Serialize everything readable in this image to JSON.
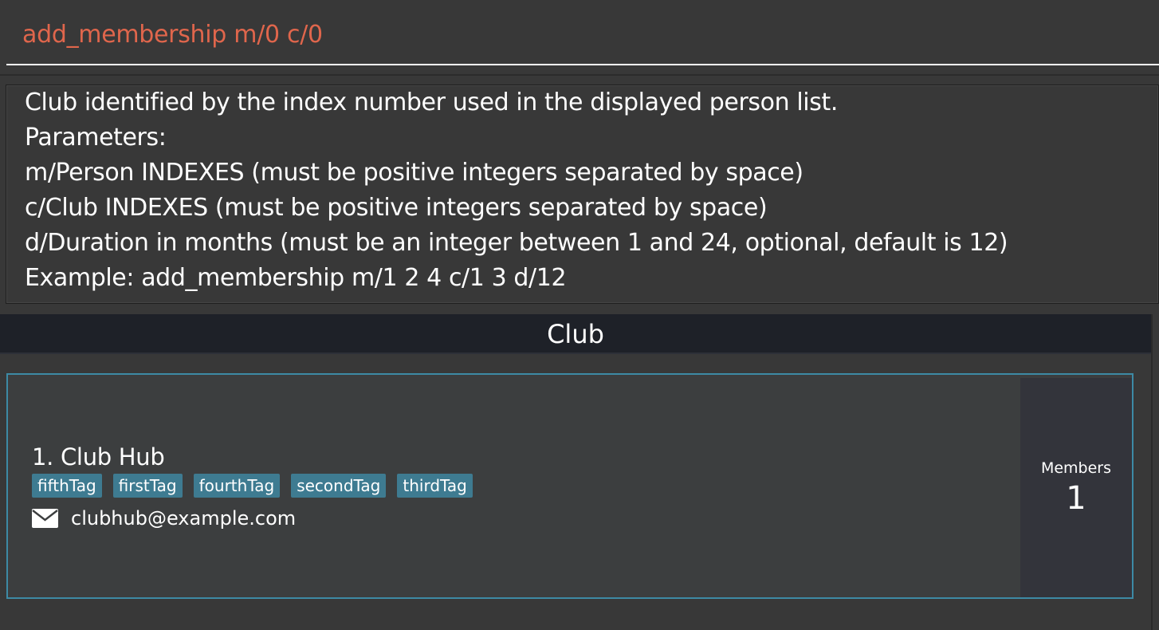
{
  "command": {
    "value": "add_membership m/0 c/0"
  },
  "result": {
    "lines": [
      "Club identified by the index number used in the displayed person list.",
      "Parameters:",
      "m/Person INDEXES (must be positive integers separated by space)",
      "c/Club INDEXES (must be positive integers separated by space)",
      "d/Duration in months (must be an integer between 1 and 24, optional, default is 12)",
      "Example: add_membership m/1 2 4 c/1 3 d/12"
    ]
  },
  "list_pane": {
    "title": "Club"
  },
  "club": {
    "name": "1. Club Hub",
    "tags": [
      "fifthTag",
      "firstTag",
      "fourthTag",
      "secondTag",
      "thirdTag"
    ],
    "email_icon": "mail-icon",
    "email": "clubhub@example.com",
    "members_label": "Members",
    "members_count": "1"
  },
  "colors": {
    "command_text": "#e0664c",
    "card_border": "#3d8aa5",
    "tag_bg": "#3e7b91",
    "header_bg": "#1e2128"
  }
}
